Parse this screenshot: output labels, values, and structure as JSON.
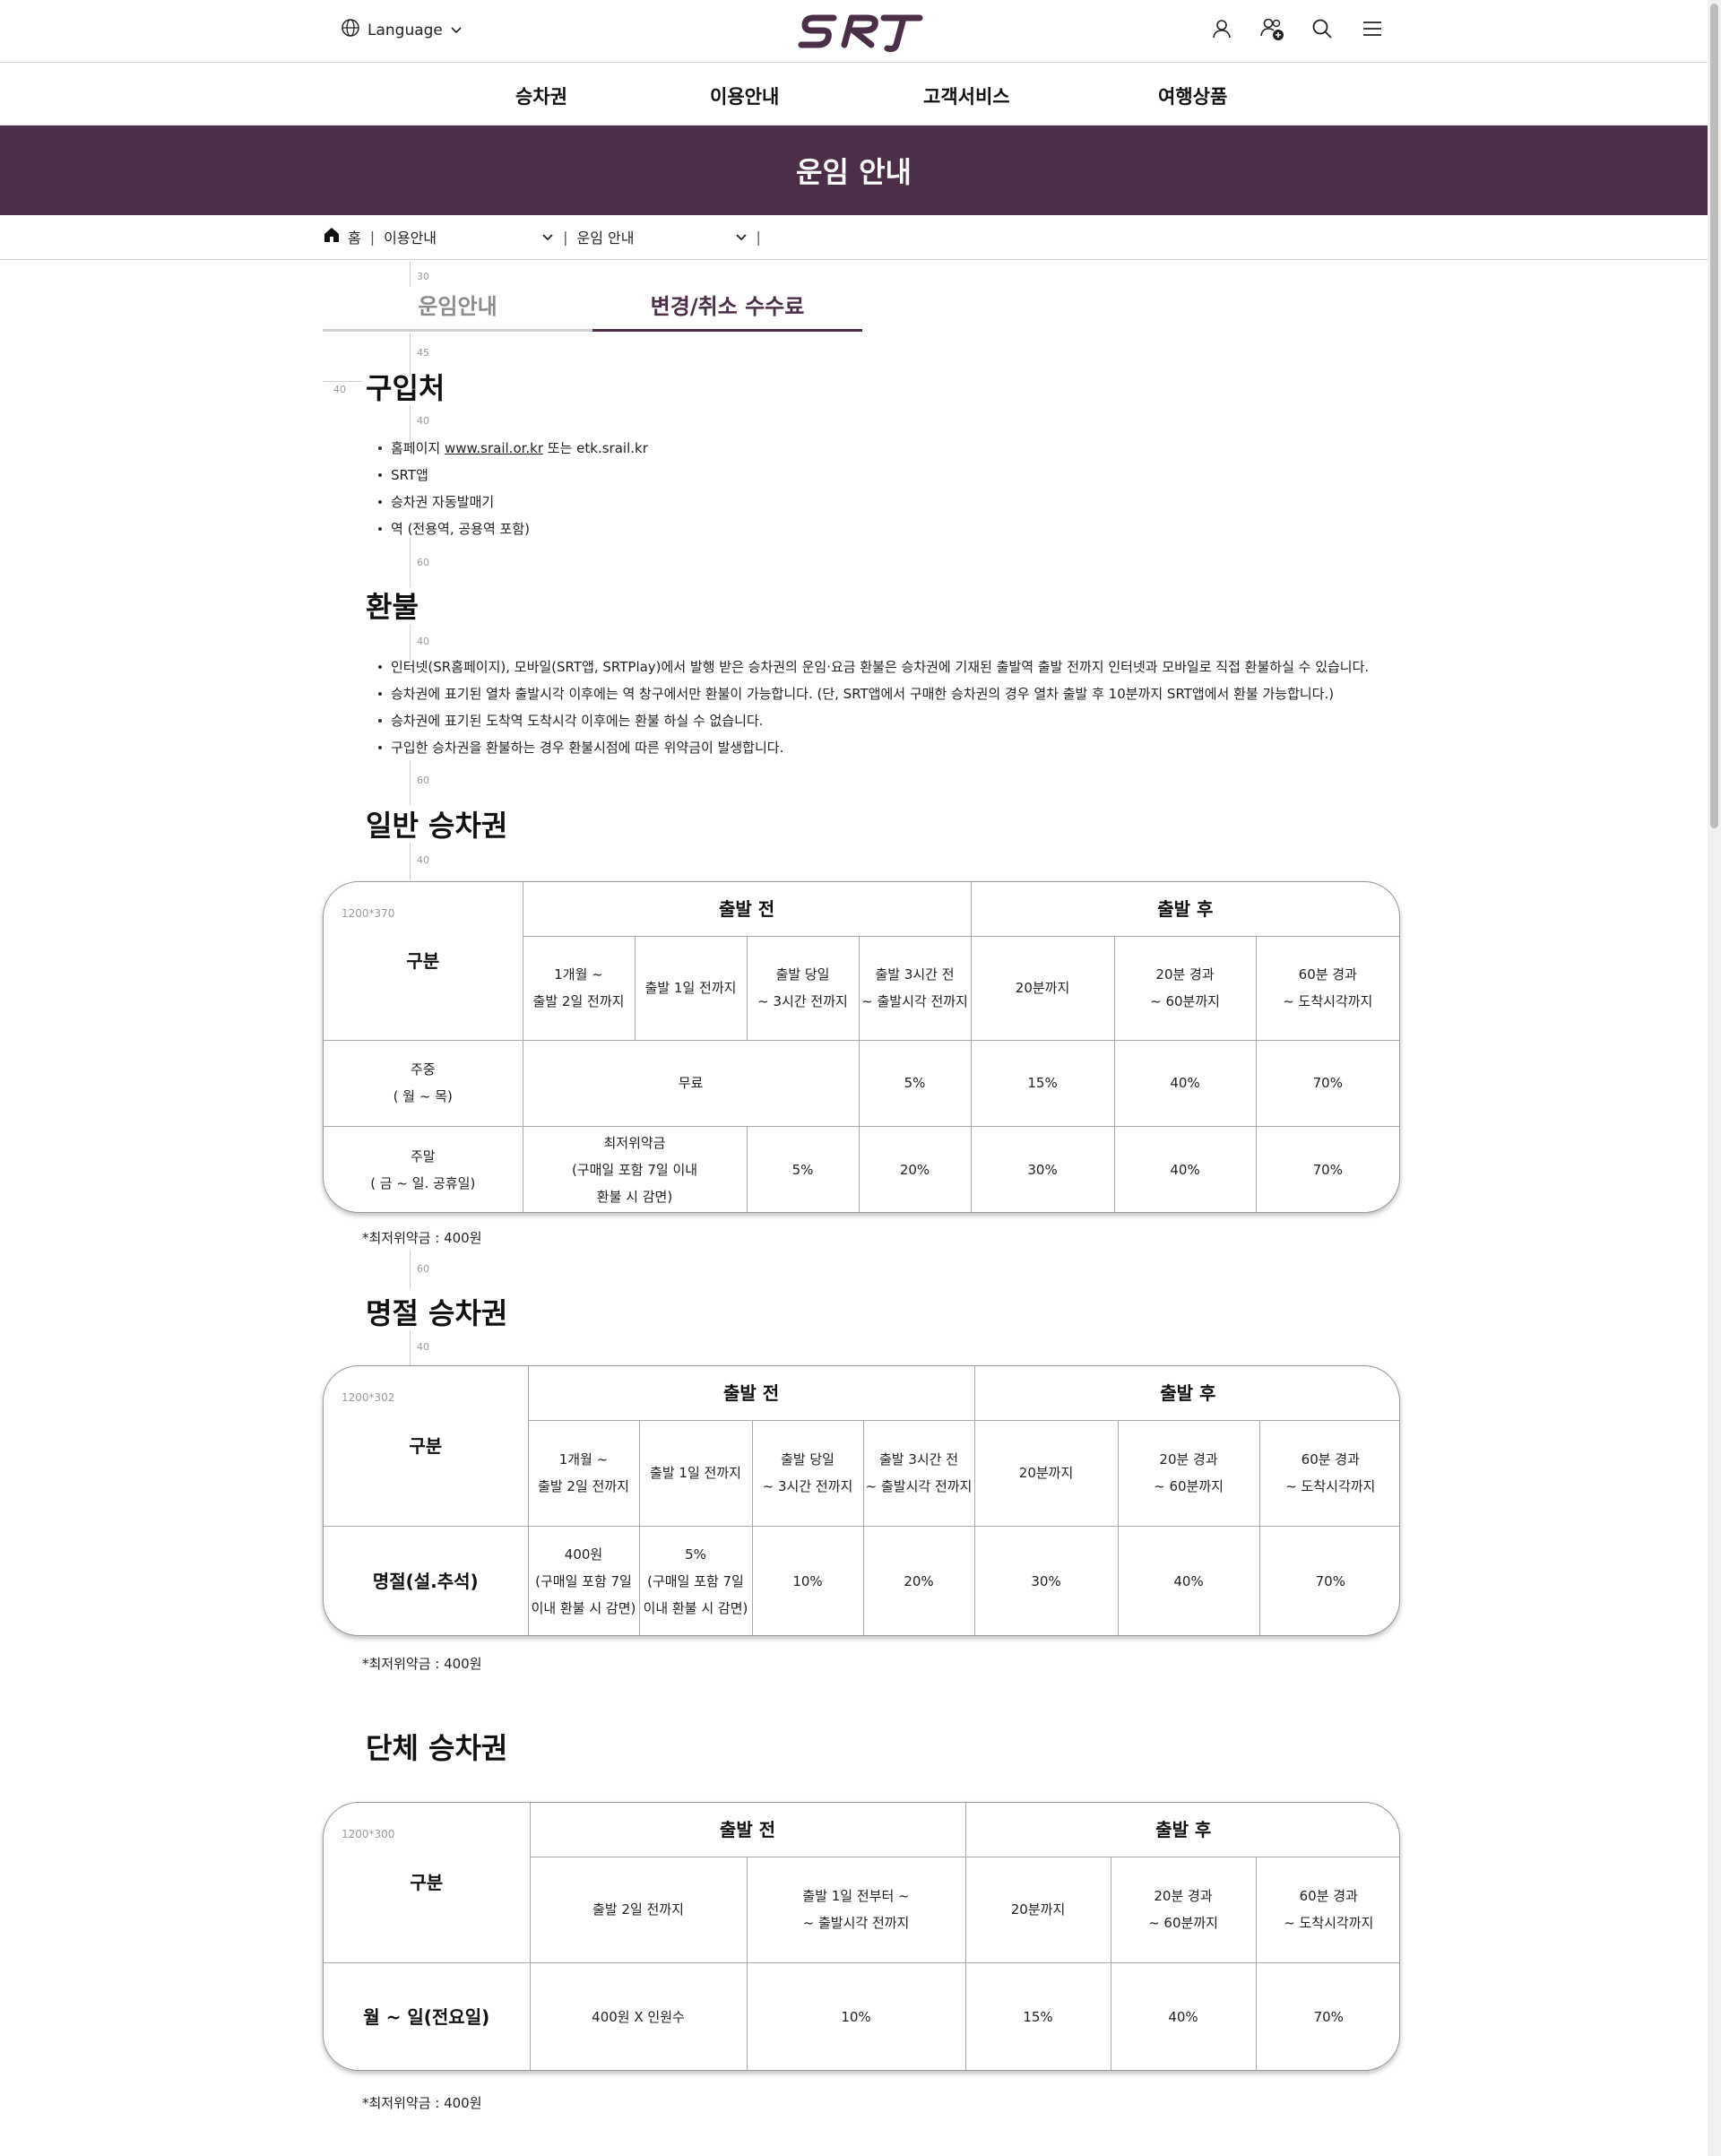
{
  "header": {
    "language_label": "Language",
    "logo_text": "SRT",
    "icons": [
      "user-icon",
      "add-user-icon",
      "search-icon",
      "menu-icon"
    ]
  },
  "gnb": [
    "승차권",
    "이용안내",
    "고객서비스",
    "여행상품"
  ],
  "banner": {
    "title": "운임 안내"
  },
  "breadcrumb": {
    "home": "홈",
    "level1": "이용안내",
    "level2": "운임 안내"
  },
  "tabs": [
    {
      "label": "운임안내",
      "active": false
    },
    {
      "label": "변경/취소 수수료",
      "active": true
    }
  ],
  "guides": {
    "g1": "30",
    "g2": "45",
    "g3": "40",
    "g4": "40",
    "g5": "60",
    "g6": "40",
    "g7": "60",
    "g8": "40",
    "g9": "60",
    "g10": "40"
  },
  "sections": {
    "purchase": {
      "title": "구입처",
      "homepage_prefix": "홈페이지 ",
      "homepage_link": "www.srail.or.kr",
      "homepage_suffix": " 또는 etk.srail.kr",
      "items": [
        "SRT앱",
        "승차권 자동발매기",
        "역 (전용역, 공용역 포함)"
      ]
    },
    "refund": {
      "title": "환불",
      "items": [
        "인터넷(SR홈페이지), 모바일(SRT앱, SRTPlay)에서 발행 받은 승차권의 운임·요금 환불은 승차권에 기재된 출발역 출발 전까지 인터넷과 모바일로 직접 환불하실 수 있습니다.",
        "승차권에 표기된 열차 출발시각 이후에는 역 창구에서만 환불이 가능합니다. (단, SRT앱에서 구매한 승차권의 경우 열차 출발 후 10분까지 SRT앱에서 환불 가능합니다.)",
        "승차권에 표기된 도착역 도착시각 이후에는 환불 하실 수 없습니다.",
        "구입한 승차권을 환불하는 경우 환불시점에 따른 위약금이 발생합니다."
      ]
    },
    "general": {
      "title": "일반 승차권",
      "size_tag": "1200*370",
      "label_col": "구분",
      "before": "출발 전",
      "after": "출발 후",
      "cols": [
        "1개월 ~\n출발 2일 전까지",
        "출발 1일 전까지",
        "출발 당일\n~ 3시간 전까지",
        "출발 3시간 전\n~ 출발시각 전까지",
        "20분까지",
        "20분 경과\n~ 60분까지",
        "60분 경과\n~ 도착시각까지"
      ],
      "row1": {
        "label": "주중\n( 월 ~ 목)",
        "free": "무료",
        "c4": "5%",
        "c5": "15%",
        "c6": "40%",
        "c7": "70%"
      },
      "row2": {
        "label": "주말\n( 금 ~ 일. 공휴일)",
        "c12": "최저위약금\n(구매일 포함 7일 이내\n환불 시 감면)",
        "c3": "5%",
        "c4": "20%",
        "c5": "30%",
        "c6": "40%",
        "c7": "70%"
      },
      "note": "*최저위약금 : 400원"
    },
    "holiday": {
      "title": "명절 승차권",
      "size_tag": "1200*302",
      "label_col": "구분",
      "before": "출발 전",
      "after": "출발 후",
      "cols": [
        "1개월 ~\n출발 2일 전까지",
        "출발 1일 전까지",
        "출발 당일\n~ 3시간 전까지",
        "출발 3시간 전\n~ 출발시각 전까지",
        "20분까지",
        "20분 경과\n~ 60분까지",
        "60분 경과\n~ 도착시각까지"
      ],
      "row": {
        "label": "명절(설.추석)",
        "c1": "400원\n(구매일 포함 7일\n이내 환불 시 감면)",
        "c2": "5%\n(구매일 포함 7일\n이내 환불 시 감면)",
        "c3": "10%",
        "c4": "20%",
        "c5": "30%",
        "c6": "40%",
        "c7": "70%"
      },
      "note": "*최저위약금 : 400원"
    },
    "group": {
      "title": "단체 승차권",
      "size_tag": "1200*300",
      "label_col": "구분",
      "before": "출발 전",
      "after": "출발 후",
      "cols": [
        "출발 2일 전까지",
        "출발 1일 전부터 ~\n~ 출발시각 전까지",
        "20분까지",
        "20분 경과\n~ 60분까지",
        "60분 경과\n~ 도착시각까지"
      ],
      "row": {
        "label": "월 ~ 일(전요일)",
        "c1": "400원 X 인원수",
        "c2": "10%",
        "c3": "15%",
        "c4": "40%",
        "c5": "70%"
      },
      "note": "*최저위약금 : 400원"
    }
  },
  "colors": {
    "brand": "#4b2e48",
    "gold": "#c9b27a"
  }
}
